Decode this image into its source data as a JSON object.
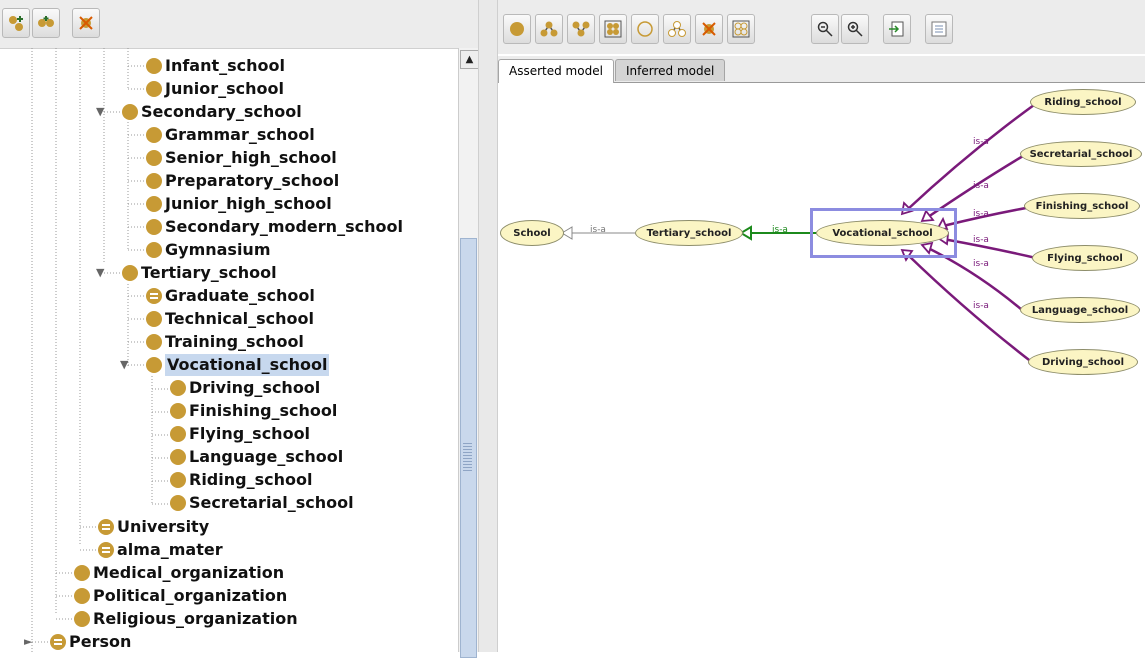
{
  "left_toolbar": {
    "buttons": [
      {
        "name": "add-subclass-icon"
      },
      {
        "name": "add-sibling-class-icon"
      },
      {
        "name": "delete-class-icon"
      }
    ]
  },
  "tree": {
    "nodes": [
      {
        "label": "Infant_school",
        "icon": "class"
      },
      {
        "label": "Junior_school",
        "icon": "class"
      },
      {
        "label": "Secondary_school",
        "icon": "class"
      },
      {
        "label": "Grammar_school",
        "icon": "class"
      },
      {
        "label": "Senior_high_school",
        "icon": "class"
      },
      {
        "label": "Preparatory_school",
        "icon": "class"
      },
      {
        "label": "Junior_high_school",
        "icon": "class"
      },
      {
        "label": "Secondary_modern_school",
        "icon": "class"
      },
      {
        "label": "Gymnasium",
        "icon": "class"
      },
      {
        "label": "Tertiary_school",
        "icon": "class"
      },
      {
        "label": "Graduate_school",
        "icon": "defined-class"
      },
      {
        "label": "Technical_school",
        "icon": "class"
      },
      {
        "label": "Training_school",
        "icon": "class"
      },
      {
        "label": "Vocational_school",
        "icon": "class",
        "selected": true
      },
      {
        "label": "Driving_school",
        "icon": "class"
      },
      {
        "label": "Finishing_school",
        "icon": "class"
      },
      {
        "label": "Flying_school",
        "icon": "class"
      },
      {
        "label": "Language_school",
        "icon": "class"
      },
      {
        "label": "Riding_school",
        "icon": "class"
      },
      {
        "label": "Secretarial_school",
        "icon": "class"
      },
      {
        "label": "University",
        "icon": "defined-class"
      },
      {
        "label": "alma_mater",
        "icon": "defined-class"
      },
      {
        "label": "Medical_organization",
        "icon": "class"
      },
      {
        "label": "Political_organization",
        "icon": "class"
      },
      {
        "label": "Religious_organization",
        "icon": "class"
      },
      {
        "label": "Person",
        "icon": "defined-class"
      }
    ]
  },
  "right_toolbar": {
    "buttons": [
      {
        "name": "show-class-icon"
      },
      {
        "name": "show-subclasses-icon"
      },
      {
        "name": "show-superclasses-icon"
      },
      {
        "name": "show-all-classes-icon"
      },
      {
        "name": "hide-class-icon"
      },
      {
        "name": "hide-subclasses-icon"
      },
      {
        "name": "hide-all-classes-icon"
      },
      {
        "name": "layout-grid-icon"
      },
      {
        "name": "zoom-out-icon"
      },
      {
        "name": "zoom-in-icon"
      },
      {
        "name": "export-icon"
      },
      {
        "name": "options-icon"
      }
    ]
  },
  "tabs": [
    {
      "label": "Asserted model",
      "active": true
    },
    {
      "label": "Inferred model",
      "active": false
    }
  ],
  "graph": {
    "nodes": {
      "school": "School",
      "tertiary": "Tertiary_school",
      "vocational": "Vocational_school",
      "riding": "Riding_school",
      "secretarial": "Secretarial_school",
      "finishing": "Finishing_school",
      "flying": "Flying_school",
      "language": "Language_school",
      "driving": "Driving_school"
    },
    "edge_label": "is-a",
    "colors": {
      "node_fill": "#fbf5c4",
      "isa_edge": "#7a1a7a",
      "selected_edge": "#1c8a1c",
      "selection_box": "#8c8ce0"
    }
  }
}
